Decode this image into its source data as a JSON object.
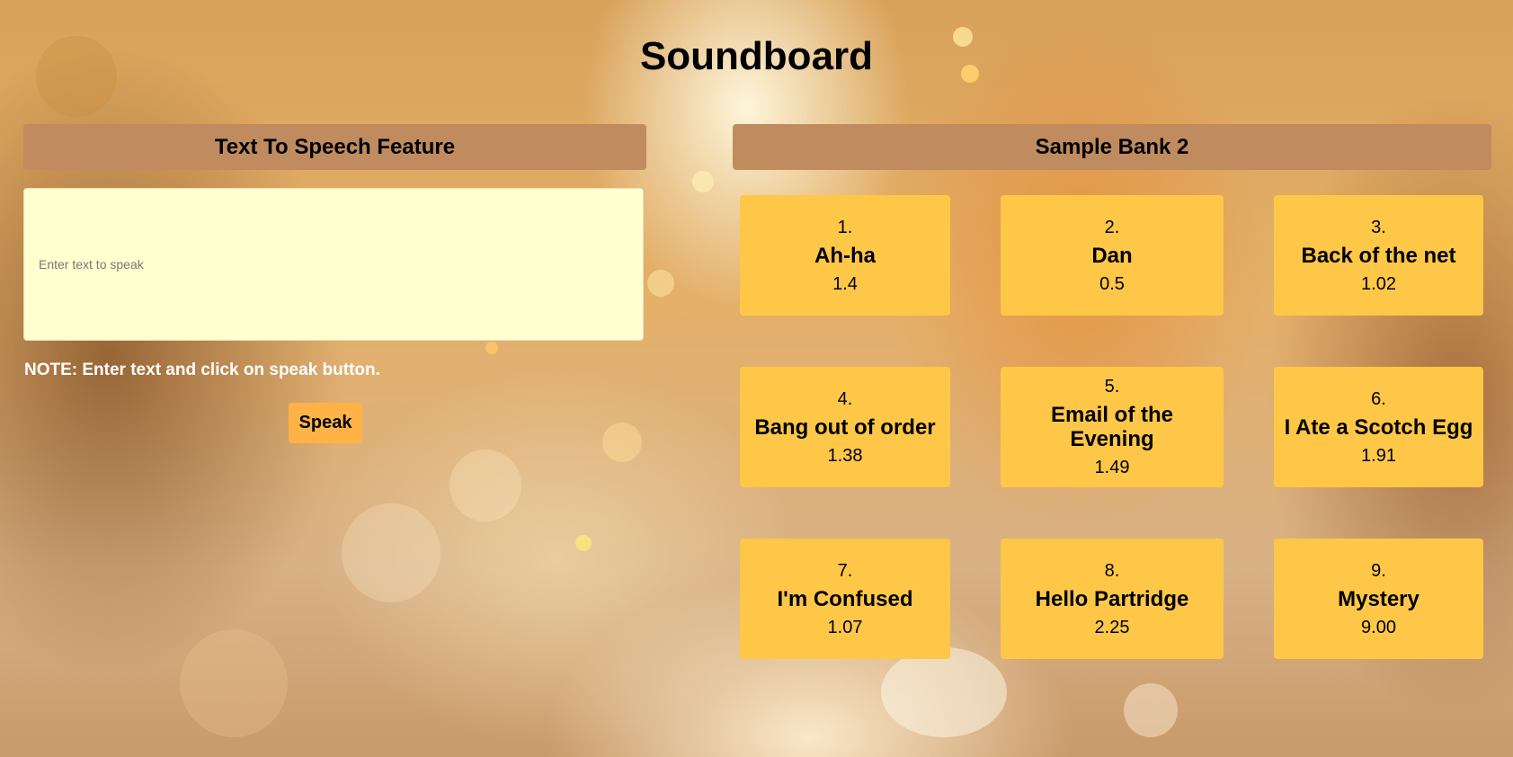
{
  "page": {
    "title": "Soundboard"
  },
  "tts": {
    "header": "Text To Speech Feature",
    "input_value": "",
    "placeholder": "Enter text to speak",
    "note": "NOTE: Enter text and click on speak button.",
    "speak_label": "Speak"
  },
  "bank": {
    "header": "Sample Bank 2",
    "samples": [
      {
        "number": "1.",
        "name": "Ah-ha",
        "duration": "1.4"
      },
      {
        "number": "2.",
        "name": "Dan",
        "duration": "0.5"
      },
      {
        "number": "3.",
        "name": "Back of the net",
        "duration": "1.02"
      },
      {
        "number": "4.",
        "name": "Bang out of order",
        "duration": "1.38"
      },
      {
        "number": "5.",
        "name": "Email of the Evening",
        "duration": "1.49"
      },
      {
        "number": "6.",
        "name": "I Ate a Scotch Egg",
        "duration": "1.91"
      },
      {
        "number": "7.",
        "name": "I'm Confused",
        "duration": "1.07"
      },
      {
        "number": "8.",
        "name": "Hello Partridge",
        "duration": "2.25"
      },
      {
        "number": "9.",
        "name": "Mystery",
        "duration": "9.00"
      }
    ]
  },
  "colors": {
    "header_bg": "#bf8b5f",
    "sample_bg": "#ffc747",
    "input_bg": "#ffffd0",
    "button_bg": "#ffb347"
  }
}
